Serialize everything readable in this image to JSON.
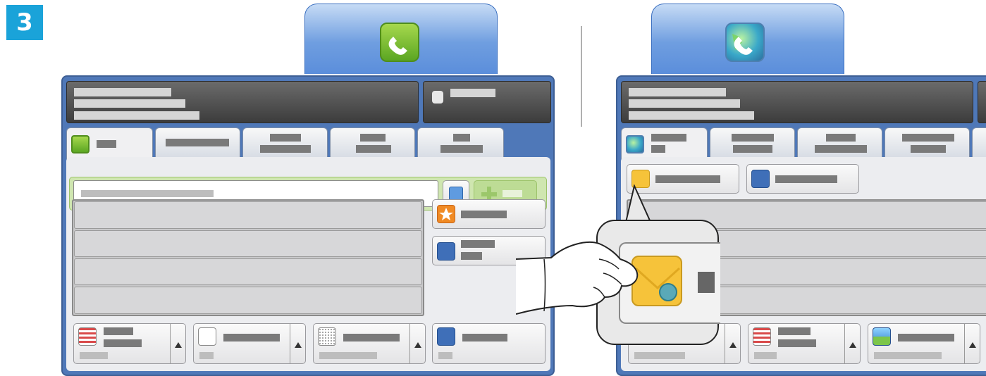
{
  "step": {
    "number": "3"
  },
  "colors": {
    "step_badge": "#1aa3d9",
    "panel_border": "#4f78b8",
    "fax_green": "#5ba622",
    "address_book_blue": "#3f6fb8",
    "favorites_orange": "#f08a24",
    "envelope_yellow": "#f6c33a"
  },
  "left_screen": {
    "top_button_icon": "phone-icon",
    "header_icon": "help-key-icon",
    "active_tab_icon": "fax-icon",
    "tab_count": 5,
    "entry_rows": 4,
    "side_buttons": [
      "favorites-star-icon",
      "address-book-icon"
    ],
    "option_icons": [
      "resolution-icon",
      "original-type-icon",
      "halftone-icon",
      "layout-icon"
    ]
  },
  "right_screen": {
    "top_button_icon": "internet-fax-icon",
    "active_tab_icon": "internet-fax-icon",
    "action_icons": [
      "envelope-gear-icon",
      "address-book-icon"
    ],
    "option_icons": [
      "original-type-icon",
      "color-mode-icon"
    ]
  },
  "callout": {
    "icon": "envelope-gear-icon"
  }
}
